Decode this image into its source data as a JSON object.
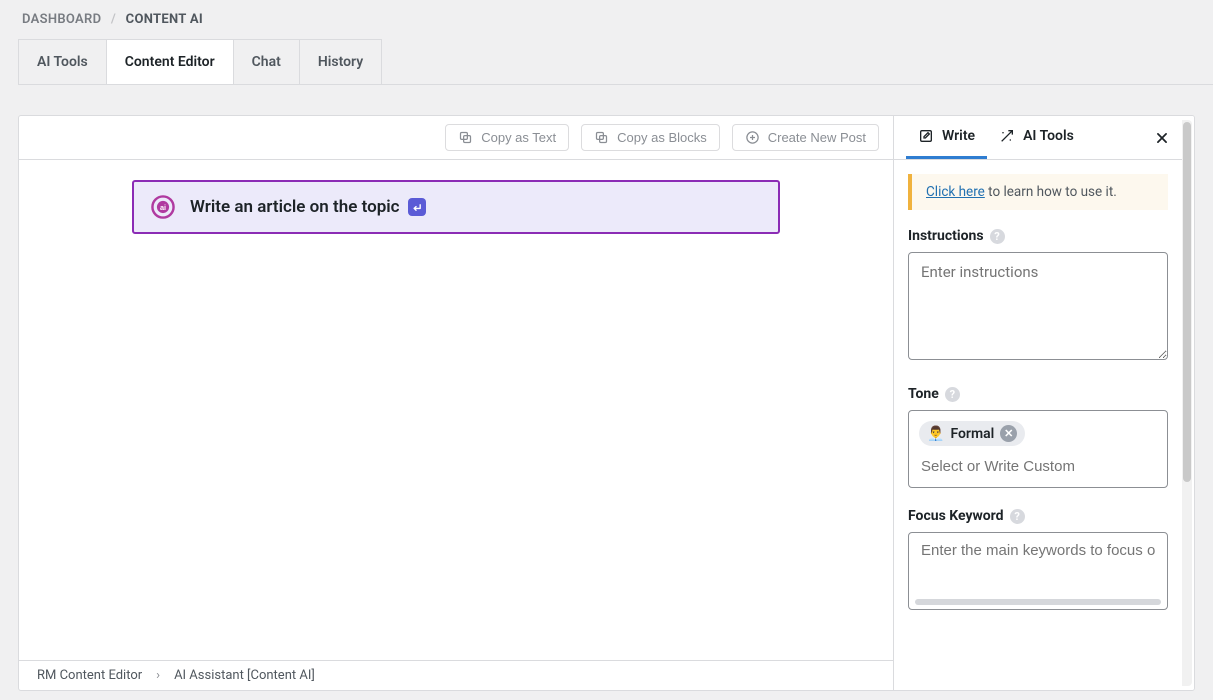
{
  "breadcrumbs": {
    "root": "DASHBOARD",
    "current": "CONTENT AI"
  },
  "top_tabs": {
    "ai_tools": "AI Tools",
    "content_editor": "Content Editor",
    "chat": "Chat",
    "history": "History"
  },
  "editor": {
    "toolbar": {
      "copy_text": "Copy as Text",
      "copy_blocks": "Copy as Blocks",
      "create_post": "Create New Post"
    },
    "ai_block": {
      "prompt": "Write an article on the topic"
    },
    "footer": {
      "root": "RM Content Editor",
      "current": "AI Assistant [Content AI]"
    }
  },
  "sidebar": {
    "tabs": {
      "write": "Write",
      "ai_tools": "AI Tools"
    },
    "tip": {
      "link_text": "Click here",
      "rest": " to learn how to use it."
    },
    "instructions": {
      "label": "Instructions",
      "placeholder": "Enter instructions"
    },
    "tone": {
      "label": "Tone",
      "chip_label": "Formal",
      "placeholder": "Select or Write Custom"
    },
    "focus_keyword": {
      "label": "Focus Keyword",
      "placeholder": "Enter the main keywords to focus o"
    }
  }
}
